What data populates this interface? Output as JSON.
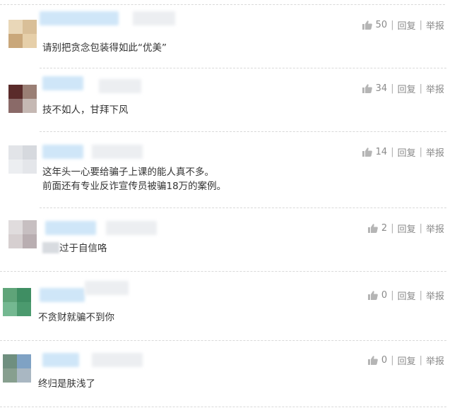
{
  "comments": [
    {
      "likes": "50",
      "reply": "回复",
      "report": "举报",
      "text": "请别把贪念包装得如此“优美”"
    },
    {
      "likes": "34",
      "reply": "回复",
      "report": "举报",
      "text": "技不如人，甘拜下风"
    },
    {
      "likes": "14",
      "reply": "回复",
      "report": "举报",
      "text_line1": "这年头一心要给骗子上课的能人真不多。",
      "text_line2": "前面还有专业反诈宣传员被骗18万的案例。"
    },
    {
      "likes": "2",
      "reply": "回复",
      "report": "举报",
      "text": "过于自信咯"
    },
    {
      "likes": "0",
      "reply": "回复",
      "report": "举报",
      "text": "不贪财就骗不到你"
    },
    {
      "likes": "0",
      "reply": "回复",
      "report": "举报",
      "text": "终归是肤浅了"
    }
  ],
  "separator": "|",
  "icons": {
    "like": "thumbs-up-icon"
  },
  "colors": {
    "text": "#333333",
    "meta": "#8a8a8a",
    "name_blur": "#cfe6f8",
    "divider": "#d9d9d9"
  }
}
